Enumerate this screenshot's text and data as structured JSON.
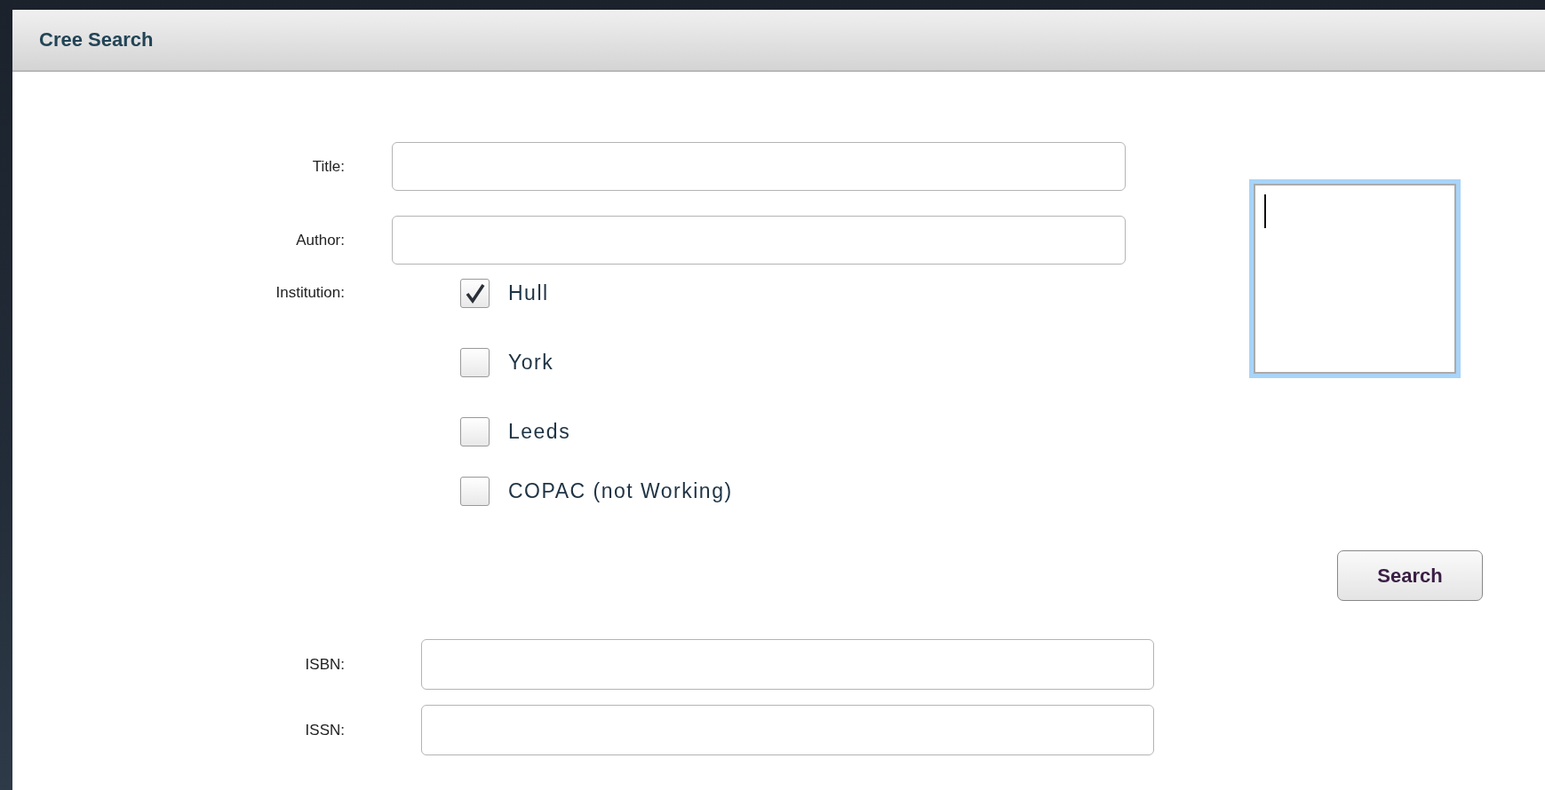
{
  "window": {
    "title": "Cree Search"
  },
  "fields": [
    {
      "label": "Title:"
    },
    {
      "label": "Author:"
    }
  ],
  "institution": {
    "label": "Institution:",
    "options": [
      {
        "label": "Hull",
        "checked": true
      },
      {
        "label": "York",
        "checked": false
      },
      {
        "label": "Leeds",
        "checked": false
      },
      {
        "label": "COPAC (not Working)",
        "checked": false
      }
    ]
  },
  "notes_box": {
    "focused": true
  },
  "search_button": "Search",
  "id_fields": [
    {
      "label": "ISBN:"
    },
    {
      "label": "ISSN:"
    }
  ]
}
